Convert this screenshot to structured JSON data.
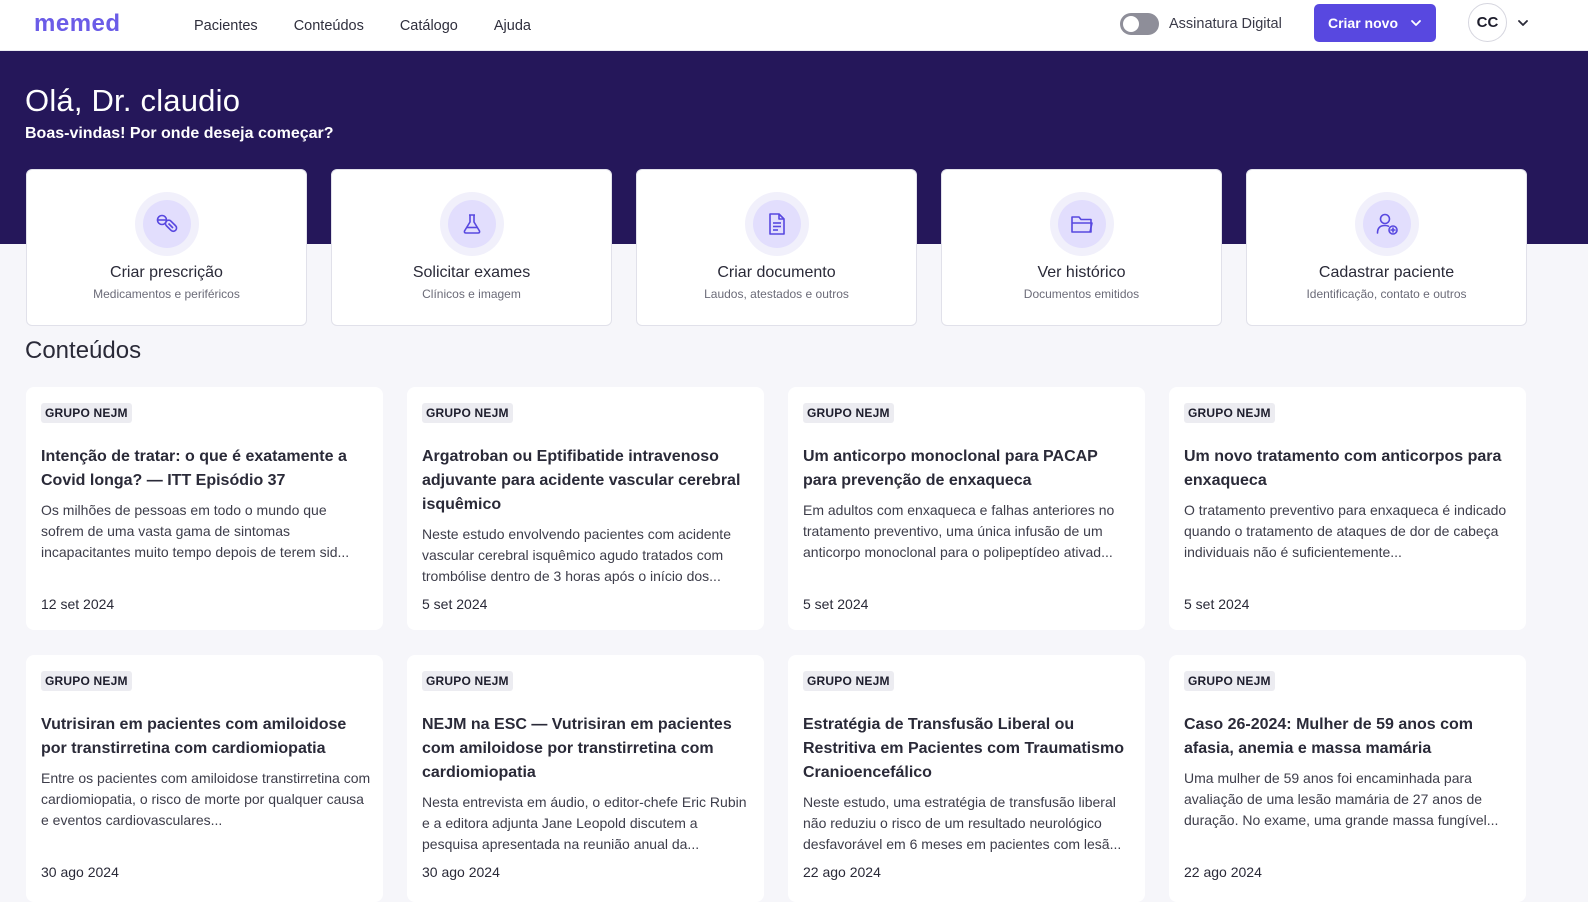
{
  "brand": {
    "logo_text": "memed",
    "color": "#5848e0"
  },
  "nav": {
    "items": [
      "Pacientes",
      "Conteúdos",
      "Catálogo",
      "Ajuda"
    ]
  },
  "signature": {
    "label": "Assinatura Digital",
    "enabled": false
  },
  "create_button": {
    "label": "Criar novo"
  },
  "user": {
    "initials": "CC"
  },
  "hero": {
    "greeting": "Olá, Dr. claudio",
    "subtitle": "Boas-vindas! Por onde deseja começar?",
    "background": "#25175a"
  },
  "actions": [
    {
      "title": "Criar prescrição",
      "subtitle": "Medicamentos e periféricos",
      "icon": "pills-icon"
    },
    {
      "title": "Solicitar exames",
      "subtitle": "Clínicos e imagem",
      "icon": "flask-icon"
    },
    {
      "title": "Criar documento",
      "subtitle": "Laudos, atestados e outros",
      "icon": "document-icon"
    },
    {
      "title": "Ver histórico",
      "subtitle": "Documentos emitidos",
      "icon": "folder-icon"
    },
    {
      "title": "Cadastrar paciente",
      "subtitle": "Identificação, contato e outros",
      "icon": "add-user-icon"
    }
  ],
  "contents": {
    "section_title": "Conteúdos",
    "cards": [
      {
        "tag": "GRUPO NEJM",
        "title": "Intenção de tratar: o que é exatamente a Covid longa? — ITT Episódio 37",
        "description": "Os milhões de pessoas em todo o mundo que sofrem de uma vasta gama de sintomas incapacitantes muito tempo depois de terem sid...",
        "date": "12 set 2024"
      },
      {
        "tag": "GRUPO NEJM",
        "title": "Argatroban ou Eptifibatide intravenoso adjuvante para acidente vascular cerebral isquêmico",
        "description": "Neste estudo envolvendo pacientes com acidente vascular cerebral isquêmico agudo tratados com trombólise dentro de 3 horas após o início dos...",
        "date": "5 set 2024"
      },
      {
        "tag": "GRUPO NEJM",
        "title": "Um anticorpo monoclonal para PACAP para prevenção de enxaqueca",
        "description": "Em adultos com enxaqueca e falhas anteriores no tratamento preventivo, uma única infusão de um anticorpo monoclonal para o polipeptídeo ativad...",
        "date": "5 set 2024"
      },
      {
        "tag": "GRUPO NEJM",
        "title": "Um novo tratamento com anticorpos para enxaqueca",
        "description": "O tratamento preventivo para enxaqueca é indicado quando o tratamento de ataques de dor de cabeça individuais não é suficientemente...",
        "date": "5 set 2024"
      },
      {
        "tag": "GRUPO NEJM",
        "title": "Vutrisiran em pacientes com amiloidose por transtirretina com cardiomiopatia",
        "description": "Entre os pacientes com amiloidose transtirretina com cardiomiopatia, o risco de morte por qualquer causa e eventos cardiovasculares...",
        "date": "30 ago 2024"
      },
      {
        "tag": "GRUPO NEJM",
        "title": "NEJM na ESC — Vutrisiran em pacientes com amiloidose por transtirretina com cardiomiopatia",
        "description": "Nesta entrevista em áudio, o editor-chefe Eric Rubin e a editora adjunta Jane Leopold discutem a pesquisa apresentada na reunião anual da...",
        "date": "30 ago 2024"
      },
      {
        "tag": "GRUPO NEJM",
        "title": "Estratégia de Transfusão Liberal ou Restritiva em Pacientes com Traumatismo Cranioencefálico",
        "description": "Neste estudo, uma estratégia de transfusão liberal não reduziu o risco de um resultado neurológico desfavorável em 6 meses em pacientes com lesã...",
        "date": "22 ago 2024"
      },
      {
        "tag": "GRUPO NEJM",
        "title": "Caso 26-2024: Mulher de 59 anos com afasia, anemia e massa mamária",
        "description": "Uma mulher de 59 anos foi encaminhada para avaliação de uma lesão mamária de 27 anos de duração. No exame, uma grande massa fungível...",
        "date": "22 ago 2024"
      }
    ]
  }
}
